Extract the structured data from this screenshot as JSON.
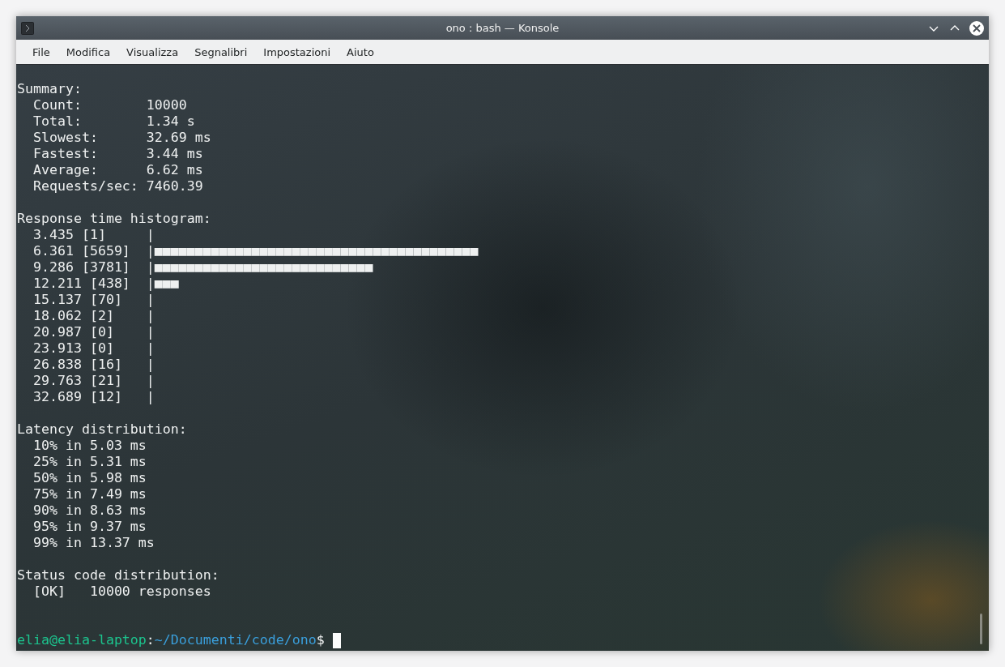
{
  "window": {
    "title": "ono : bash — Konsole"
  },
  "menu": [
    "File",
    "Modifica",
    "Visualizza",
    "Segnalibri",
    "Impostazioni",
    "Aiuto"
  ],
  "terminal": {
    "lines": [
      {
        "kind": "text",
        "text": "Summary:"
      },
      {
        "kind": "text",
        "text": "  Count:        10000"
      },
      {
        "kind": "text",
        "text": "  Total:        1.34 s"
      },
      {
        "kind": "text",
        "text": "  Slowest:      32.69 ms"
      },
      {
        "kind": "text",
        "text": "  Fastest:      3.44 ms"
      },
      {
        "kind": "text",
        "text": "  Average:      6.62 ms"
      },
      {
        "kind": "text",
        "text": "  Requests/sec: 7460.39"
      },
      {
        "kind": "blank"
      },
      {
        "kind": "text",
        "text": "Response time histogram:"
      },
      {
        "kind": "text",
        "text": "  3.435 [1]     |"
      },
      {
        "kind": "text",
        "text": "  6.361 [5659]  |■■■■■■■■■■■■■■■■■■■■■■■■■■■■■■■■■■■■■■■■"
      },
      {
        "kind": "text",
        "text": "  9.286 [3781]  |■■■■■■■■■■■■■■■■■■■■■■■■■■■"
      },
      {
        "kind": "text",
        "text": "  12.211 [438]  |■■■"
      },
      {
        "kind": "text",
        "text": "  15.137 [70]   |"
      },
      {
        "kind": "text",
        "text": "  18.062 [2]    |"
      },
      {
        "kind": "text",
        "text": "  20.987 [0]    |"
      },
      {
        "kind": "text",
        "text": "  23.913 [0]    |"
      },
      {
        "kind": "text",
        "text": "  26.838 [16]   |"
      },
      {
        "kind": "text",
        "text": "  29.763 [21]   |"
      },
      {
        "kind": "text",
        "text": "  32.689 [12]   |"
      },
      {
        "kind": "blank"
      },
      {
        "kind": "text",
        "text": "Latency distribution:"
      },
      {
        "kind": "text",
        "text": "  10% in 5.03 ms"
      },
      {
        "kind": "text",
        "text": "  25% in 5.31 ms"
      },
      {
        "kind": "text",
        "text": "  50% in 5.98 ms"
      },
      {
        "kind": "text",
        "text": "  75% in 7.49 ms"
      },
      {
        "kind": "text",
        "text": "  90% in 8.63 ms"
      },
      {
        "kind": "text",
        "text": "  95% in 9.37 ms"
      },
      {
        "kind": "text",
        "text": "  99% in 13.37 ms"
      },
      {
        "kind": "blank"
      },
      {
        "kind": "text",
        "text": "Status code distribution:"
      },
      {
        "kind": "text",
        "text": "  [OK]   10000 responses"
      },
      {
        "kind": "blank"
      },
      {
        "kind": "blank"
      },
      {
        "kind": "prompt",
        "user": "elia@elia-laptop",
        "separator": ":",
        "path": "~/Documenti/code/ono",
        "symbol": "$"
      }
    ]
  }
}
